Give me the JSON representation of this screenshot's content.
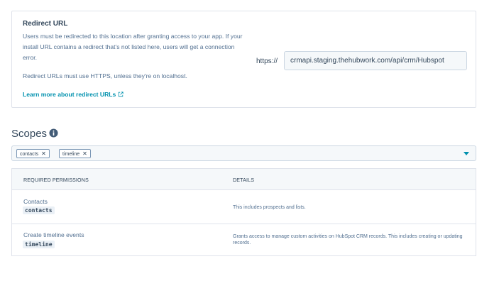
{
  "redirect": {
    "title": "Redirect URL",
    "description": "Users must be redirected to this location after granting access to your app. If your install URL contains a redirect that's not listed here, users will get a connection error.",
    "note": "Redirect URLs must use HTTPS, unless they're on localhost.",
    "learn_more": "Learn more about redirect URLs",
    "prefix": "https://",
    "url_value": "crmapi.staging.thehubwork.com/api/crm/Hubspot"
  },
  "scopes": {
    "heading": "Scopes",
    "tags": [
      "contacts",
      "timeline"
    ],
    "remove_glyph": "✕"
  },
  "table": {
    "headers": [
      "REQUIRED PERMISSIONS",
      "DETAILS"
    ],
    "rows": [
      {
        "name": "Contacts",
        "code": "contacts",
        "details": "This includes prospects and lists."
      },
      {
        "name": "Create timeline events",
        "code": "timeline",
        "details": "Grants access to manage custom activities on HubSpot CRM records. This includes creating or updating records."
      }
    ]
  },
  "colors": {
    "link": "#0091ae",
    "text": "#33475b",
    "border": "#dfe3eb",
    "info_icon": "#425b76"
  },
  "icons": {
    "external": "external-link-icon",
    "info": "info-icon",
    "caret": "caret-down-icon"
  }
}
